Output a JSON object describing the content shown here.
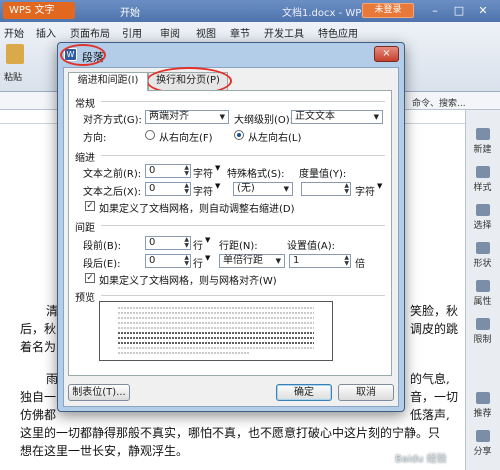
{
  "app": {
    "app_name": "WPS 文字",
    "menu": [
      "开始",
      "插入",
      "页面布局",
      "引用",
      "审阅",
      "视图",
      "章节",
      "开发工具",
      "特色应用"
    ],
    "document_title": "文档1.docx - WPS 文字",
    "login_label": "未登录",
    "ribbon_active_tab": "开始",
    "paste_label": "粘贴",
    "tab_search_hint": "命令、搜索...",
    "right_panel": [
      "新建",
      "样式",
      "选择",
      "形状",
      "属性",
      "限制",
      "推荐",
      "分享"
    ],
    "watermark": "Baidu 经验"
  },
  "document": {
    "lines": [
      "清",
      "后，秋",
      "着名为",
      "雨",
      "独自一",
      "仿佛都",
      "这里的一切都静得那般不真实，哪怕不真，也不愿意打破心中这片刻的宁静。只",
      "想在这里一世长安，静观浮生。"
    ],
    "right_fragments": [
      {
        "text": "笑脸，秋"
      },
      {
        "text": "调皮的跳"
      },
      {
        "text": "的气息,"
      },
      {
        "text": "音，一切"
      },
      {
        "text": "低落声,"
      }
    ]
  },
  "dialog": {
    "title": "段落",
    "close_label": "×",
    "tabs": [
      "缩进和间距(I)",
      "换行和分页(P)"
    ],
    "general": {
      "section_label": "常规",
      "alignment_label": "对齐方式(G):",
      "alignment_value": "两端对齐",
      "outline_label": "大纲级别(O):",
      "outline_value": "正文文本",
      "direction_label": "方向:",
      "direction_rtl": "从右向左(F)",
      "direction_ltr": "从左向右(L)",
      "direction_selected": "ltr"
    },
    "indent": {
      "section_label": "缩进",
      "before_label": "文本之前(R):",
      "before_value": "0",
      "before_unit": "字符",
      "after_label": "文本之后(X):",
      "after_value": "0",
      "after_unit": "字符",
      "special_label": "特殊格式(S):",
      "special_value": "(无)",
      "measure_label": "度量值(Y):",
      "measure_value": "",
      "measure_unit": "字符",
      "auto_adjust_label": "如果定义了文档网格，则自动调整右缩进(D)",
      "auto_adjust_checked": true
    },
    "spacing": {
      "section_label": "间距",
      "before_label": "段前(B):",
      "before_value": "0",
      "before_unit": "行",
      "after_label": "段后(E):",
      "after_value": "0",
      "after_unit": "行",
      "line_label": "行距(N):",
      "line_value": "单倍行距",
      "setting_label": "设置值(A):",
      "setting_value": "1",
      "setting_unit": "倍",
      "grid_label": "如果定义了文档网格，则与网格对齐(W)",
      "grid_checked": true
    },
    "preview": {
      "section_label": "预览"
    },
    "buttons": {
      "tabs_label": "制表位(T)...",
      "ok_label": "确定",
      "cancel_label": "取消"
    },
    "annotation_color": "#e0322a"
  }
}
